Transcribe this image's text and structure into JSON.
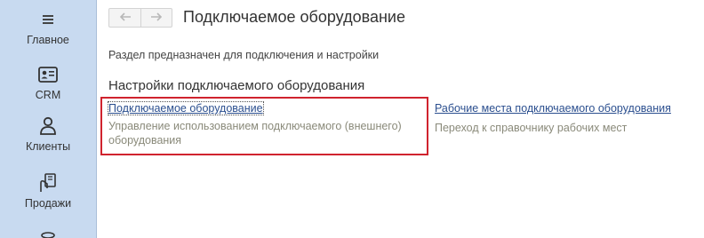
{
  "sidebar": {
    "items": [
      {
        "label": "Главное",
        "icon": "menu-icon"
      },
      {
        "label": "CRM",
        "icon": "contact-card-icon"
      },
      {
        "label": "Клиенты",
        "icon": "person-icon"
      },
      {
        "label": "Продажи",
        "icon": "hand-card-icon"
      },
      {
        "label": "",
        "icon": "box-icon"
      }
    ]
  },
  "header": {
    "back_icon": "arrow-left-icon",
    "forward_icon": "arrow-right-icon",
    "title": "Подключаемое оборудование"
  },
  "main": {
    "description": "Раздел предназначен для подключения и настройки",
    "section_title": "Настройки подключаемого оборудования",
    "links": [
      {
        "label": "Подключаемое оборудование",
        "hint": "Управление использованием подключаемого (внешнего) оборудования"
      },
      {
        "label": "Рабочие места подключаемого оборудования",
        "hint": "Переход к справочнику рабочих мест"
      }
    ]
  },
  "colors": {
    "sidebar_bg": "#c8daf0",
    "link": "#2b4f8f",
    "hint": "#8a8a7a",
    "highlight_border": "#d0232e"
  }
}
